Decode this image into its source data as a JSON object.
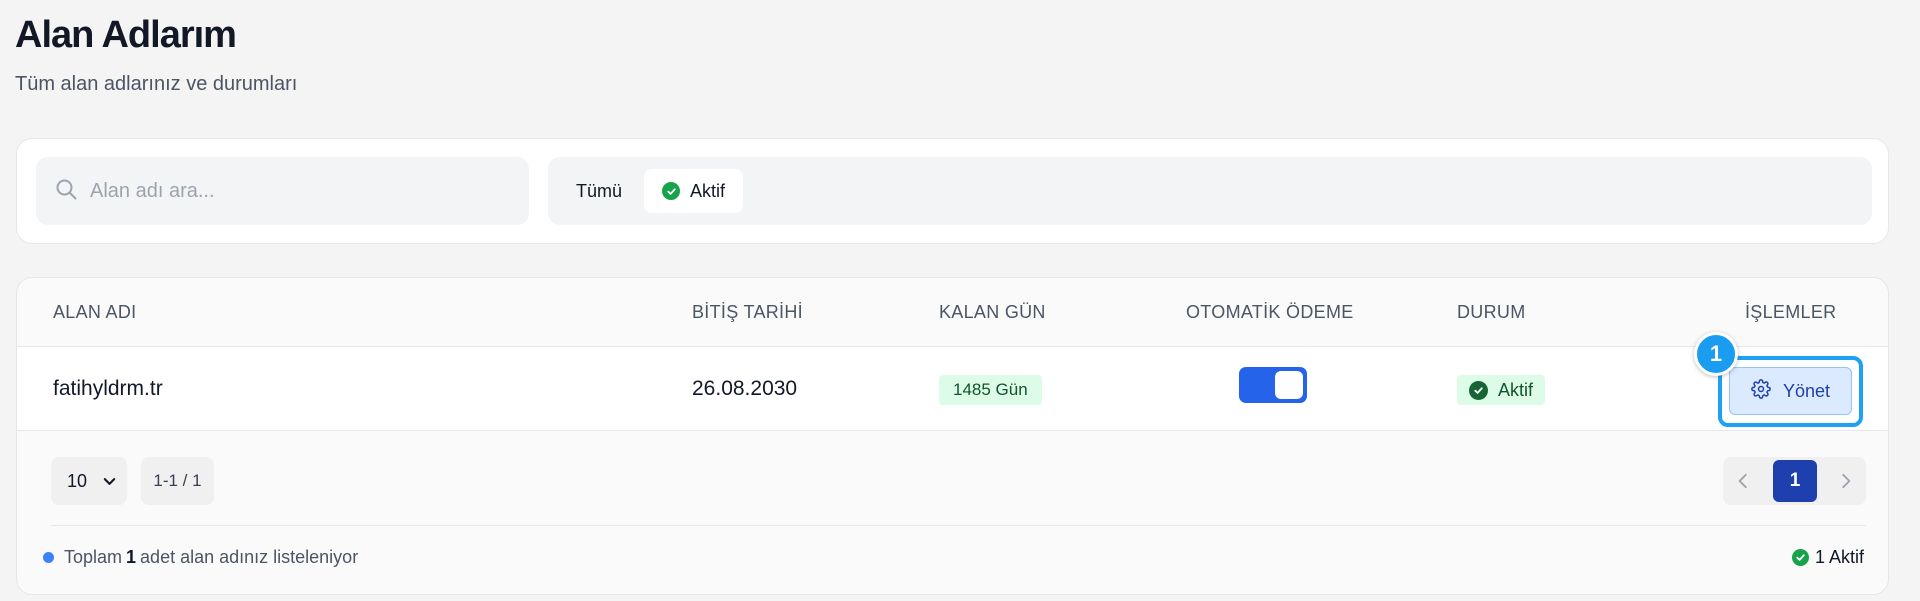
{
  "page": {
    "title": "Alan Adlarım",
    "subtitle": "Tüm alan adlarınız ve durumları"
  },
  "search": {
    "placeholder": "Alan adı ara..."
  },
  "filters": {
    "all_label": "Tümü",
    "active_label": "Aktif"
  },
  "table": {
    "headers": [
      "ALAN ADI",
      "BİTİŞ TARİHİ",
      "KALAN GÜN",
      "OTOMATİK ÖDEME",
      "DURUM",
      "İŞLEMLER"
    ],
    "rows": [
      {
        "domain": "fatihyldrm.tr",
        "expiry": "26.08.2030",
        "days_left": "1485 Gün",
        "auto_pay": true,
        "status": "Aktif",
        "action": "Yönet"
      }
    ]
  },
  "annotation": {
    "step": "1"
  },
  "pagination": {
    "page_size": "10",
    "range": "1-1 / 1",
    "current_page": "1"
  },
  "footer": {
    "prefix": "Toplam",
    "count": "1",
    "suffix": "adet alan adınız listeleniyor",
    "active_summary": "1 Aktif"
  },
  "colors": {
    "accent": "#2563eb",
    "success": "#16a34a",
    "highlight": "#1da1f2"
  },
  "icons": [
    "search-icon",
    "check-circle-icon",
    "gear-icon",
    "chevron-down-icon",
    "chevron-left-icon",
    "chevron-right-icon"
  ]
}
